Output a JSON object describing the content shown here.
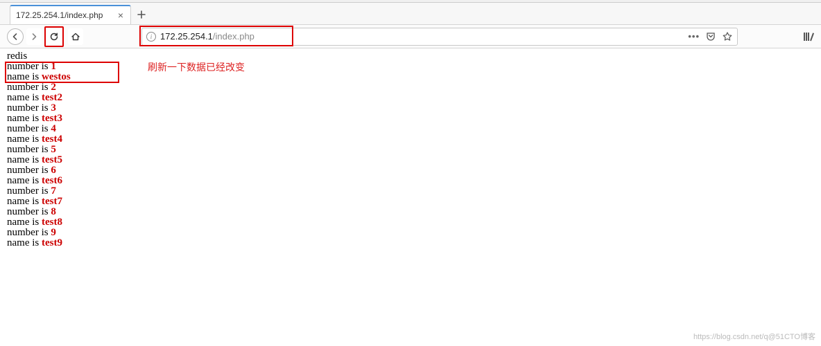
{
  "tab": {
    "title": "172.25.254.1/index.php"
  },
  "urlbar": {
    "host": "172.25.254.1",
    "path": "/index.php"
  },
  "annotation": "刷新一下数据已经改变",
  "page": {
    "header": "redis",
    "rows": [
      {
        "number": "1",
        "name": "westos"
      },
      {
        "number": "2",
        "name": "test2"
      },
      {
        "number": "3",
        "name": "test3"
      },
      {
        "number": "4",
        "name": "test4"
      },
      {
        "number": "5",
        "name": "test5"
      },
      {
        "number": "6",
        "name": "test6"
      },
      {
        "number": "7",
        "name": "test7"
      },
      {
        "number": "8",
        "name": "test8"
      },
      {
        "number": "9",
        "name": "test9"
      }
    ],
    "labels": {
      "number": "number is ",
      "name": "name is "
    }
  },
  "watermark": "https://blog.csdn.net/q@51CTO博客"
}
